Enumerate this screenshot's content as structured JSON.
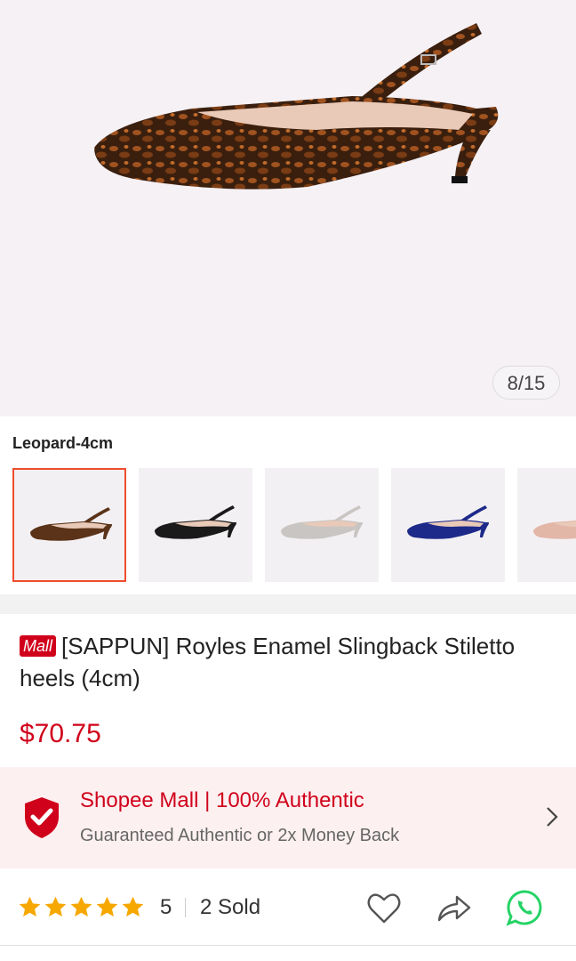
{
  "gallery": {
    "counter": "8/15"
  },
  "variant": {
    "label": "Leopard-4cm",
    "options": [
      {
        "name": "Leopard",
        "color": "#5a3318",
        "selected": true
      },
      {
        "name": "Black",
        "color": "#1a1a1a",
        "selected": false
      },
      {
        "name": "Grey",
        "color": "#c9c5c2",
        "selected": false
      },
      {
        "name": "Navy",
        "color": "#1e2a8a",
        "selected": false
      },
      {
        "name": "Pink",
        "color": "#e3b7a8",
        "selected": false
      }
    ]
  },
  "product": {
    "badge": "Mall",
    "title": "[SAPPUN] Royles Enamel Slingback Stiletto heels (4cm)",
    "price": "$70.75"
  },
  "mall_banner": {
    "title": "Shopee Mall | 100% Authentic",
    "subtitle": "Guaranteed Authentic or 2x Money Back"
  },
  "stats": {
    "rating": "5",
    "stars": 5,
    "sold": "2 Sold"
  },
  "colors": {
    "brand_red": "#d0011b",
    "star": "#f6a700",
    "whatsapp": "#25d366"
  }
}
